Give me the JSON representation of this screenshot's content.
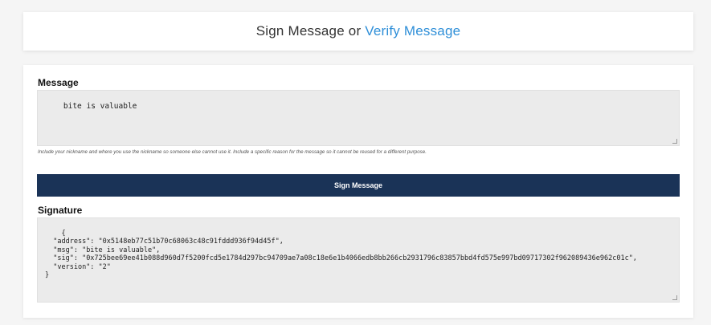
{
  "header": {
    "title_prefix": "Sign Message or ",
    "verify_link": "Verify Message"
  },
  "message": {
    "label": "Message",
    "value": "bite is valuable",
    "hint": "Include your nickname and where you use the nickname so someone else cannot use it. Include a specific reason for the message so it cannot be reused for a different purpose."
  },
  "sign_button": {
    "label": "Sign Message"
  },
  "signature": {
    "label": "Signature",
    "value": "{\n  \"address\": \"0x5148eb77c51b70c68063c48c91fddd936f94d45f\",\n  \"msg\": \"bite is valuable\",\n  \"sig\": \"0x725bee69ee41b088d960d7f5200fcd5e1784d297bc94709ae7a08c18e6e1b4066edb8bb266cb2931796c83857bbd4fd575e997bd09717302f962089436e962c01c\",\n  \"version\": \"2\"\n}"
  },
  "colors": {
    "link": "#2f8fd8",
    "button_bg": "#1a3357",
    "textarea_bg": "#ebebeb"
  }
}
